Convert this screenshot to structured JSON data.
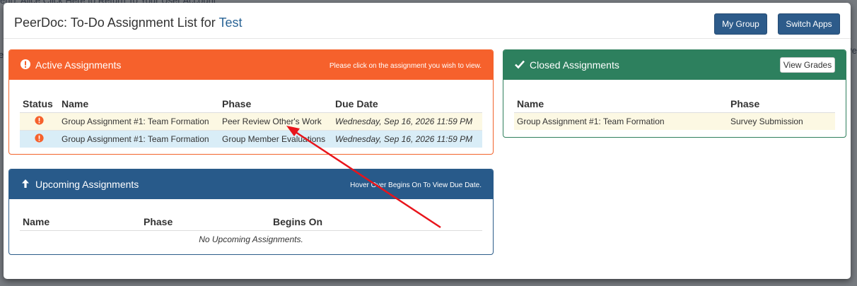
{
  "background": {
    "top_text": "ent): Alice    Click Here to Return To Your User Account",
    "left_edge": "e",
    "right_edge": "Pe"
  },
  "modal": {
    "title_prefix": "PeerDoc: To-Do Assignment List for ",
    "title_course": "Test",
    "buttons": {
      "my_group": "My Group",
      "switch_apps": "Switch Apps"
    }
  },
  "active": {
    "title": "Active Assignments",
    "note": "Please click on the assignment you wish to view.",
    "columns": [
      "Status",
      "Name",
      "Phase",
      "Due Date"
    ],
    "rows": [
      {
        "name": "Group Assignment #1: Team Formation",
        "phase": "Peer Review Other's Work",
        "due": "Wednesday, Sep 16, 2026 11:59 PM",
        "status_icon": "exclamation-circle-icon"
      },
      {
        "name": "Group Assignment #1: Team Formation",
        "phase": "Group Member Evaluations",
        "due": "Wednesday, Sep 16, 2026 11:59 PM",
        "status_icon": "exclamation-circle-icon"
      }
    ]
  },
  "closed": {
    "title": "Closed Assignments",
    "view_grades": "View Grades",
    "columns": [
      "Name",
      "Phase"
    ],
    "rows": [
      {
        "name": "Group Assignment #1: Team Formation",
        "phase": "Survey Submission"
      }
    ]
  },
  "upcoming": {
    "title": "Upcoming Assignments",
    "note": "Hover Over Begins On To View Due Date.",
    "columns": [
      "Name",
      "Phase",
      "Begins On"
    ],
    "empty": "No Upcoming Assignments."
  },
  "colors": {
    "active": "#f6612c",
    "closed": "#2d805e",
    "upcoming": "#285a8a",
    "button": "#2d5b8a",
    "annotation_arrow": "#e8141b"
  }
}
